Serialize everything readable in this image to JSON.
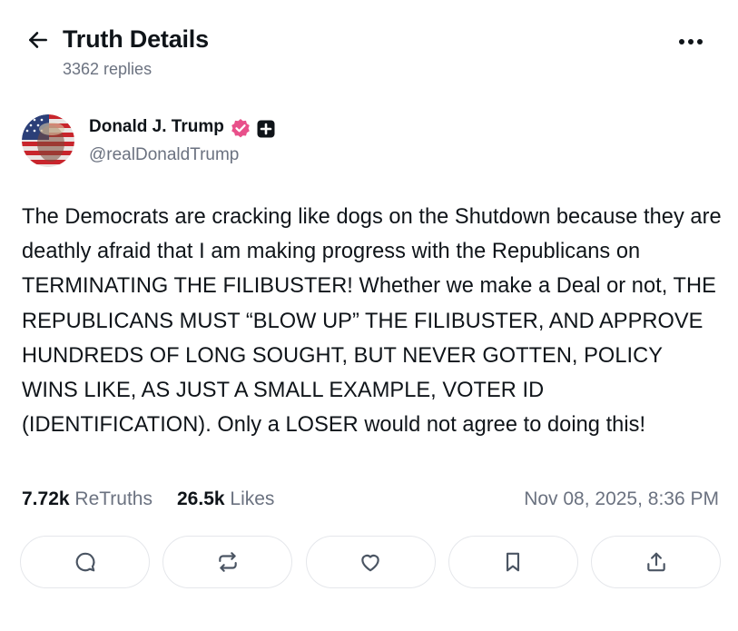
{
  "header": {
    "title": "Truth Details",
    "reply_count": "3362 replies",
    "back_icon": "arrow-left-icon",
    "more_icon": "more-horizontal-icon"
  },
  "author": {
    "name": "Donald J. Trump",
    "handle": "@realDonaldTrump",
    "verified_color": "#e8508a"
  },
  "post": {
    "text": "The Democrats are cracking like dogs on the Shutdown because they are deathly afraid that I am making progress with the Republicans on TERMINATING THE FILIBUSTER! Whether we make a Deal or not, THE REPUBLICANS MUST “BLOW UP” THE FILIBUSTER, AND APPROVE HUNDREDS OF LONG SOUGHT, BUT NEVER GOTTEN, POLICY WINS LIKE, AS JUST A SMALL EXAMPLE, VOTER ID (IDENTIFICATION). Only a LOSER would not agree to doing this!"
  },
  "stats": {
    "retruths_count": "7.72k",
    "retruths_label": "ReTruths",
    "likes_count": "26.5k",
    "likes_label": "Likes",
    "timestamp": "Nov 08, 2025, 8:36 PM"
  },
  "actions": [
    {
      "icon": "reply-icon"
    },
    {
      "icon": "retruth-icon"
    },
    {
      "icon": "heart-icon"
    },
    {
      "icon": "bookmark-icon"
    },
    {
      "icon": "share-icon"
    }
  ]
}
